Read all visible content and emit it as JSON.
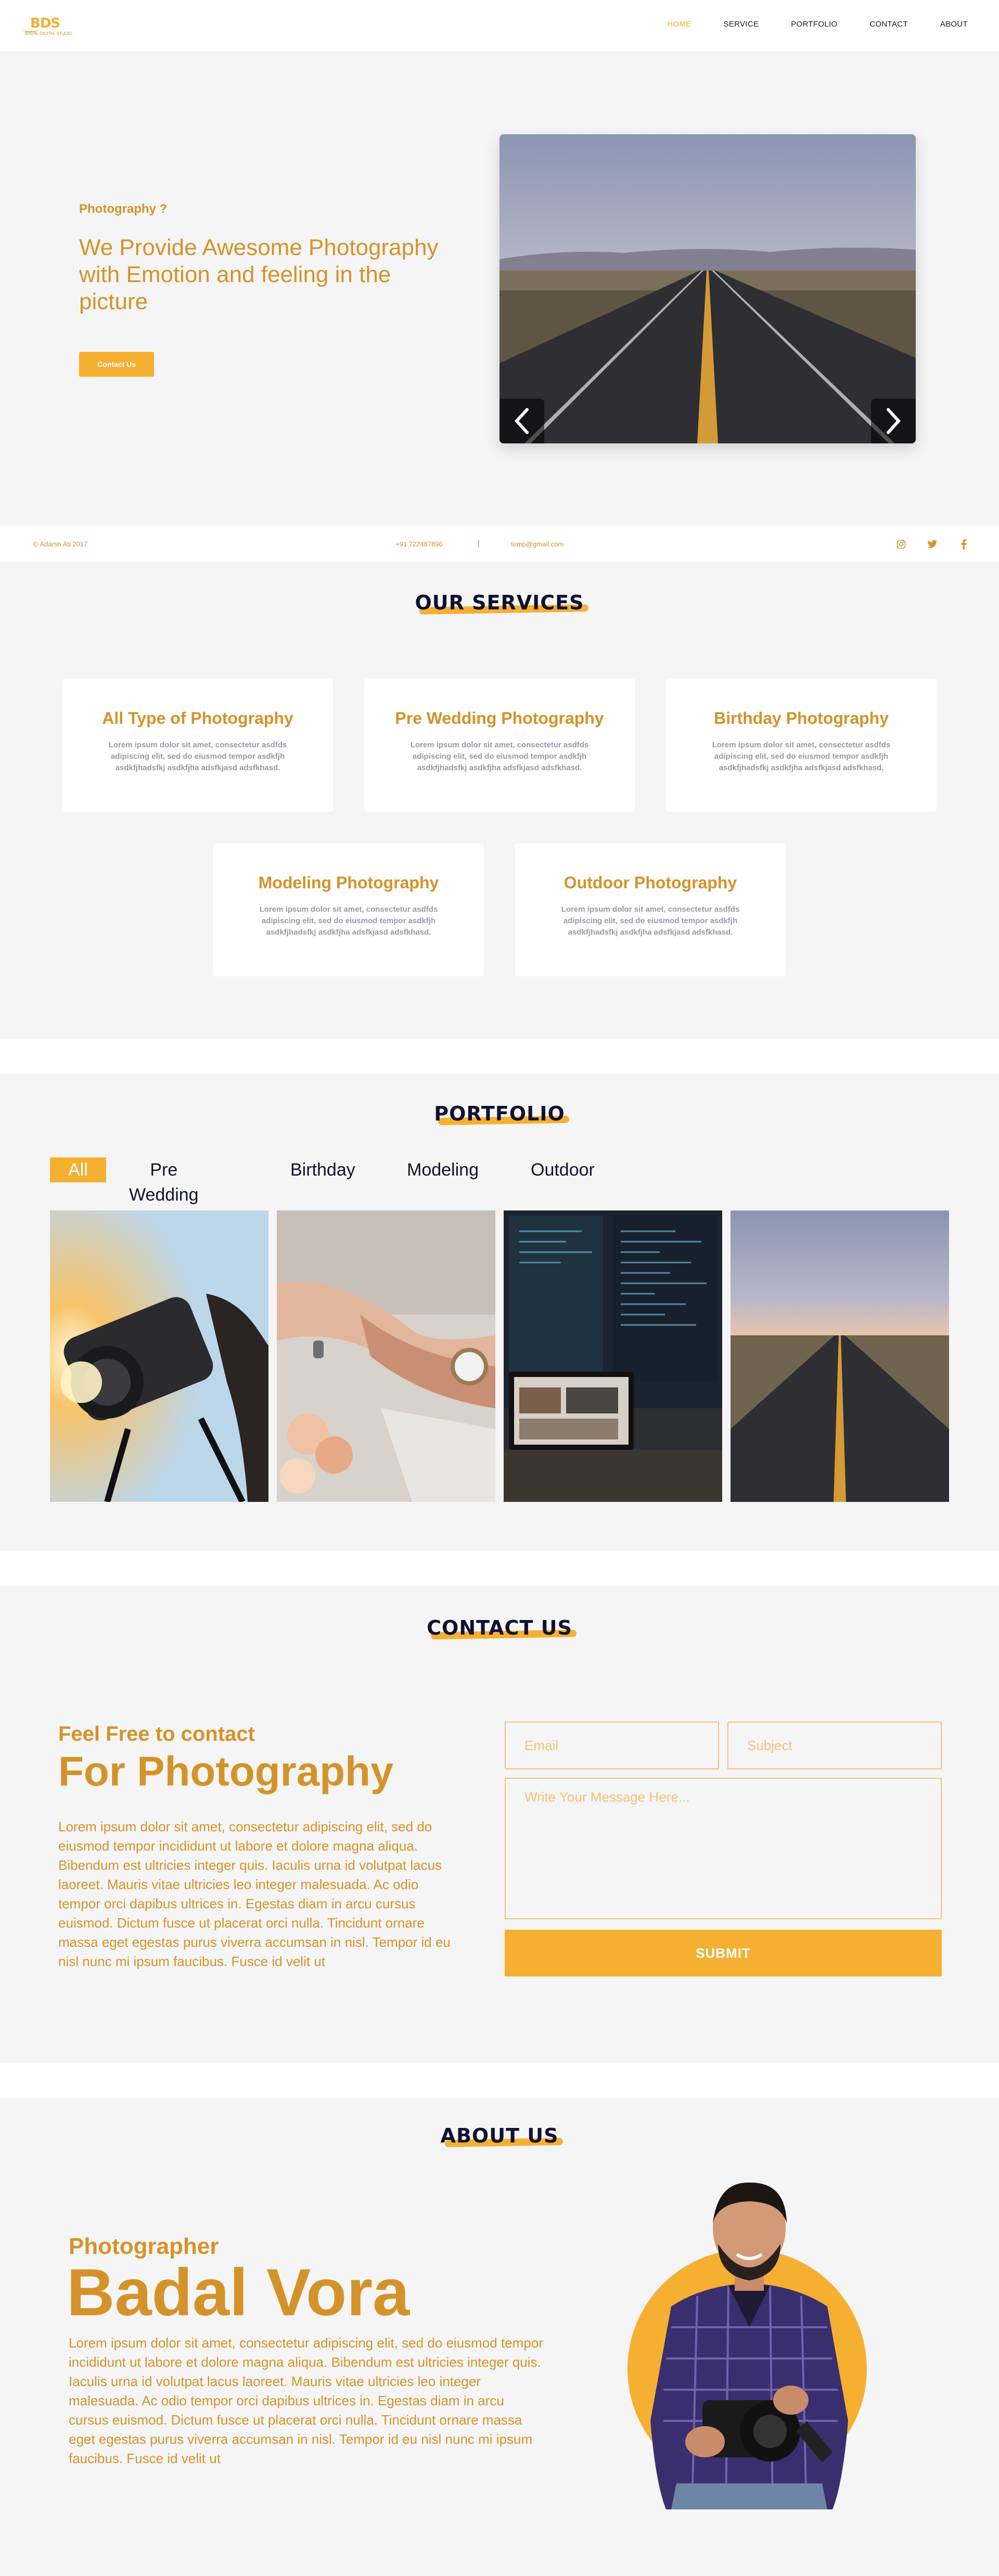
{
  "header": {
    "logo_mark": "BDS",
    "logo_sub": "BADAL DIGITAL STUDIO",
    "nav": [
      "HOME",
      "SERVICE",
      "PORTFOLIO",
      "CONTACT",
      "ABOUT"
    ],
    "active_nav": "HOME"
  },
  "hero": {
    "kicker": "Photography ?",
    "title": "We Provide Awesome Photography with Emotion and feeling in the picture",
    "button": "Contact Us",
    "image": "desert-road-sunset"
  },
  "infobar": {
    "copyright": "© Adarsh Ati 2017",
    "phone": "+91 722487896",
    "separator": "|",
    "email": "temp@gmail.com",
    "social": [
      "instagram-icon",
      "twitter-icon",
      "facebook-icon"
    ]
  },
  "services": {
    "title": "OUR SERVICES",
    "cards": [
      {
        "title": "All Type of Photography",
        "text": "Lorem ipsum dolor sit amet, consectetur asdfds adipiscing elit, sed do eiusmod tempor asdkfjh asdkfjhadsfkj asdkfjha adsfkjasd adsfkhasd."
      },
      {
        "title": "Pre Wedding Photography",
        "text": "Lorem ipsum dolor sit amet, consectetur asdfds adipiscing elit, sed do eiusmod tempor asdkfjh asdkfjhadsfkj asdkfjha adsfkjasd adsfkhasd."
      },
      {
        "title": "Birthday Photography",
        "text": "Lorem ipsum dolor sit amet, consectetur asdfds adipiscing elit, sed do eiusmod tempor asdkfjh asdkfjhadsfkj asdkfjha adsfkjasd adsfkhasd."
      },
      {
        "title": "Modeling Photography",
        "text": "Lorem ipsum dolor sit amet, consectetur asdfds adipiscing elit, sed do eiusmod tempor asdkfjh asdkfjhadsfkj asdkfjha adsfkjasd adsfkhasd."
      },
      {
        "title": "Outdoor Photography",
        "text": "Lorem ipsum dolor sit amet, consectetur asdfds adipiscing elit, sed do eiusmod tempor asdkfjh asdkfjhadsfkj asdkfjha adsfkjasd adsfkhasd."
      }
    ]
  },
  "portfolio": {
    "title": "PORTFOLIO",
    "filters": [
      "All",
      "Pre Wedding",
      "Birthday",
      "Modeling",
      "Outdoor"
    ],
    "active_filter": "All",
    "images": [
      "camera-in-hands",
      "wedding-rings-hands",
      "monitor-code-laptop",
      "desert-road-sunset"
    ]
  },
  "contact": {
    "title": "CONTACT US",
    "kicker": "Feel Free to contact",
    "heading": "For Photography",
    "body": " Lorem ipsum dolor sit amet, consectetur adipiscing elit, sed do eiusmod tempor incididunt ut labore et dolore magna aliqua. Bibendum est ultricies integer quis. Iaculis urna id volutpat lacus laoreet. Mauris vitae ultricies leo integer malesuada. Ac odio tempor orci dapibus ultrices in. Egestas diam in arcu cursus euismod. Dictum fusce ut placerat orci nulla. Tincidunt ornare massa eget egestas purus viverra accumsan in nisl. Tempor id eu nisl nunc mi ipsum faucibus. Fusce id velit ut",
    "email_placeholder": "Email",
    "subject_placeholder": "Subject",
    "message_placeholder": "Write Your Message Here...",
    "submit": "SUBMIT"
  },
  "about": {
    "title": "ABOUT US",
    "kicker": "Photographer",
    "name": "Badal Vora",
    "body": " Lorem ipsum dolor sit amet, consectetur adipiscing elit, sed do eiusmod tempor incididunt ut labore et dolore magna aliqua. Bibendum est ultricies integer quis. Iaculis urna id volutpat lacus laoreet. Mauris vitae ultricies leo integer malesuada. Ac odio tempor orci dapibus ultrices in. Egestas diam in arcu cursus euismod. Dictum fusce ut placerat orci nulla. Tincidunt ornare massa eget egestas purus viverra accumsan in nisl. Tempor id eu nisl nunc mi ipsum faucibus. Fusce id velit ut"
  },
  "colors": {
    "accent": "#f5b032",
    "text_gold": "#d4932a",
    "navy": "#111230",
    "section_bg": "#f5f5f5"
  }
}
